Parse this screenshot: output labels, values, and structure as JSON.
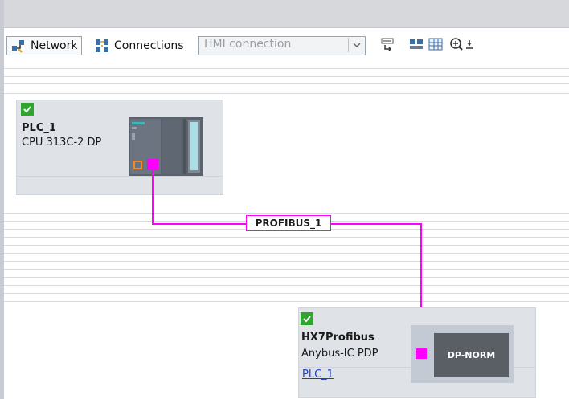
{
  "toolbar": {
    "network_label": "Network",
    "connections_label": "Connections",
    "hmi_select": {
      "value": "HMI connection"
    },
    "icons": [
      "network-view-icon",
      "connections-icon",
      "chevron-down-icon",
      "name-icon",
      "show-address-icon",
      "grid-icon",
      "zoom-in-icon"
    ]
  },
  "devices": [
    {
      "name": "PLC_1",
      "type": "CPU 313C-2 DP",
      "status": "ok"
    },
    {
      "name": "HX7Profibus",
      "type": "Anybus-IC PDP",
      "link": "PLC_1",
      "module_label": "DP-NORM",
      "status": "ok"
    }
  ],
  "network": {
    "label": "PROFIBUS_1",
    "color": "#ff00ff"
  },
  "colors": {
    "profibus": "#ff00ff",
    "check": "#2fa52f",
    "device_bg": "#dfe3e8",
    "module_dark": "#5a5f66"
  }
}
